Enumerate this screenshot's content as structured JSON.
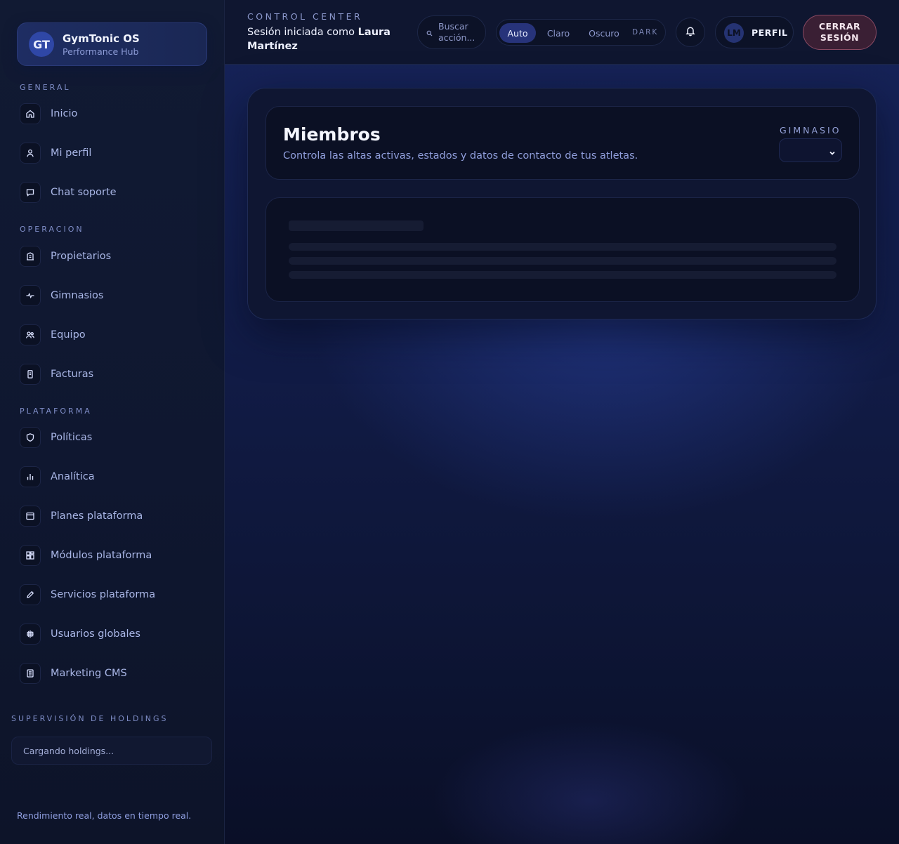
{
  "sidebar": {
    "brand": {
      "initials": "GT",
      "name": "GymTonic OS",
      "subtitle": "Performance Hub"
    },
    "sections": [
      {
        "title": "GENERAL",
        "items": [
          {
            "label": "Inicio",
            "icon": "home-icon"
          },
          {
            "label": "Mi perfil",
            "icon": "user-icon"
          },
          {
            "label": "Chat soporte",
            "icon": "chat-icon"
          }
        ]
      },
      {
        "title": "OPERACION",
        "items": [
          {
            "label": "Propietarios",
            "icon": "building-icon"
          },
          {
            "label": "Gimnasios",
            "icon": "activity-icon"
          },
          {
            "label": "Equipo",
            "icon": "users-icon"
          },
          {
            "label": "Facturas",
            "icon": "receipt-icon"
          }
        ]
      },
      {
        "title": "PLATAFORMA",
        "items": [
          {
            "label": "Políticas",
            "icon": "shield-icon"
          },
          {
            "label": "Analítica",
            "icon": "bar-chart-icon"
          },
          {
            "label": "Planes plataforma",
            "icon": "calendar-icon"
          },
          {
            "label": "Módulos plataforma",
            "icon": "modules-icon"
          },
          {
            "label": "Servicios plataforma",
            "icon": "pencil-icon"
          },
          {
            "label": "Usuarios globales",
            "icon": "globe-icon"
          },
          {
            "label": "Marketing CMS",
            "icon": "document-icon"
          }
        ]
      }
    ],
    "holdings": {
      "title": "SUPERVISIÓN DE HOLDINGS",
      "status": "Cargando holdings..."
    },
    "footer": "Rendimiento real, datos en tiempo real."
  },
  "topbar": {
    "label": "CONTROL CENTER",
    "session_prefix": "Sesión iniciada como ",
    "user_name": "Laura Martínez",
    "search_placeholder": "Buscar acción...",
    "theme_options": [
      "Auto",
      "Claro",
      "Oscuro"
    ],
    "theme_active": "Auto",
    "theme_tag": "DARK",
    "profile_initials": "LM",
    "profile_label": "PERFIL",
    "logout_label": "CERRAR SESIÓN"
  },
  "main": {
    "title": "Miembros",
    "subtitle": "Controla las altas activas, estados y datos de contacto de tus atletas.",
    "gym_filter_label": "GIMNASIO",
    "gym_filter_value": ""
  },
  "colors": {
    "accent": "#27337a",
    "logout_border": "#8a4a63",
    "background": "#0b1022"
  }
}
